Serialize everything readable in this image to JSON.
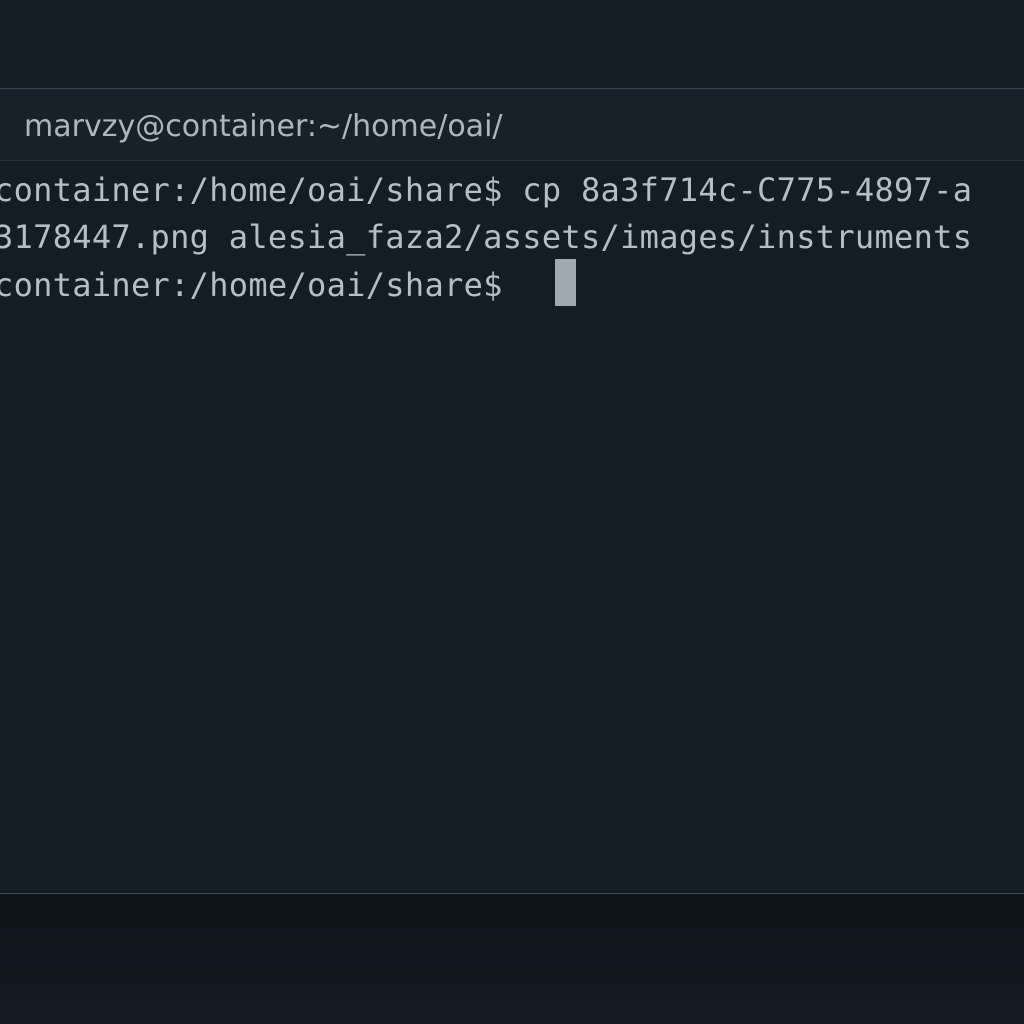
{
  "window": {
    "title": "marvzy@container:~/home/oai/"
  },
  "terminal": {
    "lines": [
      "container:/home/oai/share$ cp 8a3f714c-C775-4897-a",
      "3178447.png alesia_faza2/assets/images/instruments",
      "container:/home/oai/share$ "
    ]
  },
  "colors": {
    "background": "#141d26",
    "text": "#b6bdc4",
    "cursor": "#a1a9b0"
  }
}
